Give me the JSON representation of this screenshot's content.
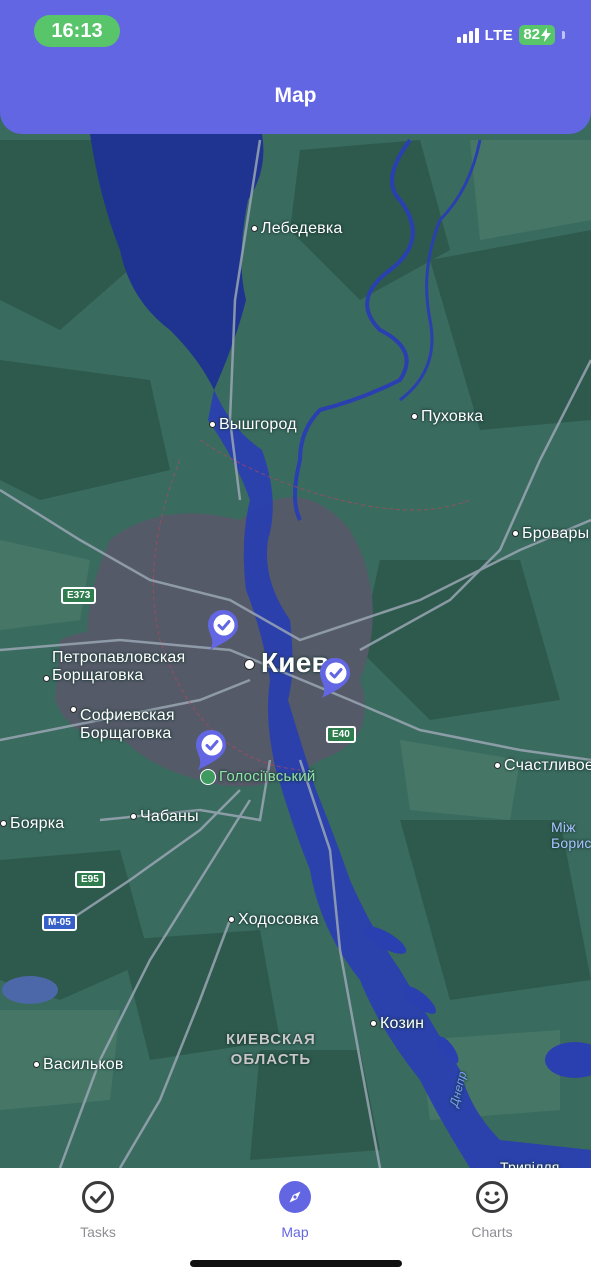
{
  "status_bar": {
    "time": "16:13",
    "network": "LTE",
    "battery": "82"
  },
  "header": {
    "title": "Map"
  },
  "map": {
    "places": {
      "lebedevka": "Лебедевка",
      "vyshgorod": "Вышгород",
      "pukhovka": "Пуховка",
      "brovary": "Бровары",
      "kiev": "Киев",
      "petropavlovskaya": "Петропавловская\nБорщаговка",
      "sofievskaya": "Софиевская\nБорщаговка",
      "holosiivskyi": "Голосіївський",
      "schastlivoe": "Счастливое",
      "mizh": "Між\nБорис",
      "boyarka": "Боярка",
      "chabany": "Чабаны",
      "khodosovka": "Ходосовка",
      "kozin": "Козин",
      "region": "КИЕВСКАЯ\nОБЛАСТЬ",
      "vasilkov": "Васильков",
      "dnepr": "Днепр",
      "trypillia": "Трипілля"
    },
    "road_shields": {
      "e373": "E373",
      "e40": "E40",
      "e95": "E95",
      "m05": "M-05"
    },
    "pins": [
      {
        "name": "task-pin-1",
        "status": "completed"
      },
      {
        "name": "task-pin-2",
        "status": "completed"
      },
      {
        "name": "task-pin-3",
        "status": "completed"
      }
    ]
  },
  "tabbar": {
    "tasks": "Tasks",
    "map": "Map",
    "charts": "Charts",
    "active": "Map"
  },
  "colors": {
    "accent": "#6366e3",
    "status_green": "#58c56a",
    "inactive_tab": "#8e8e93"
  }
}
